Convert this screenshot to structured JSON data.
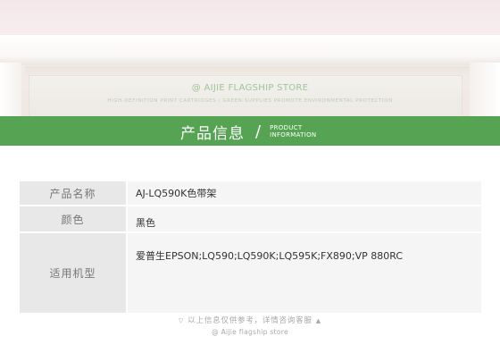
{
  "banner": {
    "store_name": "@ AIJIE FLAGSHIP STORE",
    "slogan": "HIGH-DEFINITION PRINT CARTRIDGES / GREEN SUPPLIES PROMOTE ENVIRONMENTAL PROTECTION"
  },
  "section_title": {
    "chinese": "产品信息",
    "slash": "/",
    "english_line1": "PRODUCT",
    "english_line2": "INFORMATION"
  },
  "product_info": {
    "rows": [
      {
        "label": "产品名称",
        "value": "AJ-LQ590K色带架"
      },
      {
        "label": "颜色",
        "value": "黑色"
      },
      {
        "label": "适用机型",
        "value": "爱普生EPSON;LQ590;LQ590K;LQ595K;FX890;VP 880RC"
      }
    ]
  },
  "footer": {
    "note": "以上信息仅供参考，详情咨询客服",
    "left_marker": "▽",
    "right_marker": "▲",
    "store": "@ Aijie flagship store"
  },
  "colors": {
    "accent_green": "#56a453",
    "label_bg": "#e8e8e8",
    "value_bg": "#f5f5f5"
  }
}
